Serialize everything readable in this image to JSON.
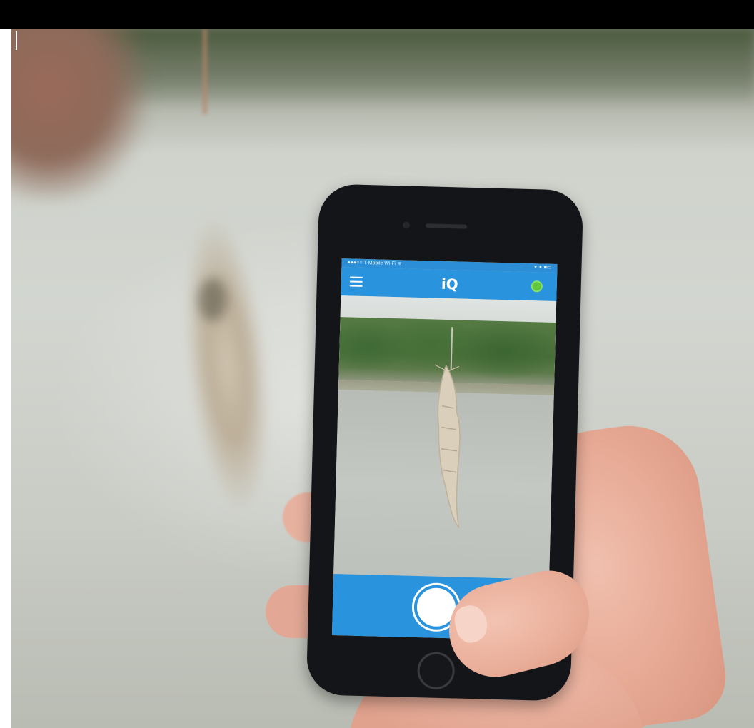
{
  "phone_app": {
    "status_bar": {
      "carrier": "●●●○○ T-Mobile Wi-Fi ᯤ",
      "right": "▾ ✦ ■▭"
    },
    "header": {
      "logo": "iQ",
      "menu_icon": "hamburger-menu-icon",
      "status_indicator_color": "#5fc93b"
    },
    "shutter": {
      "icon": "camera-shutter-icon"
    },
    "accent_color": "#2a93dd"
  }
}
